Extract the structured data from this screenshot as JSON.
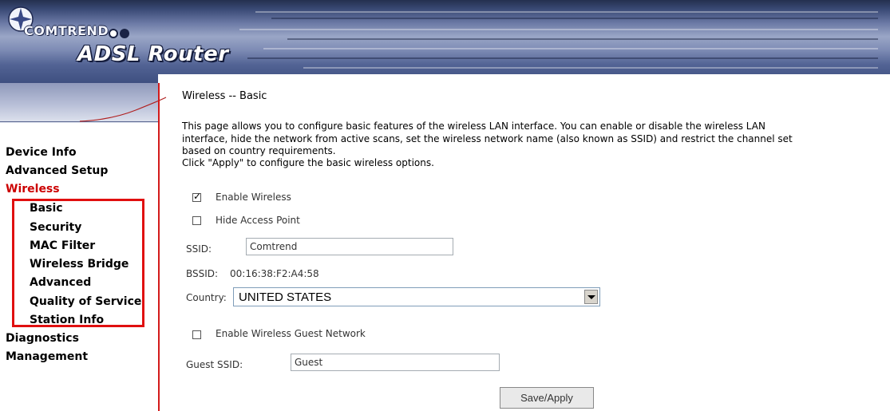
{
  "header": {
    "brand": "COMTREND",
    "product": "ADSL Router"
  },
  "nav": {
    "items": [
      {
        "label": "Device Info"
      },
      {
        "label": "Advanced Setup"
      },
      {
        "label": "Wireless",
        "active": true
      },
      {
        "label": "Basic"
      },
      {
        "label": "Security"
      },
      {
        "label": "MAC Filter"
      },
      {
        "label": "Wireless Bridge"
      },
      {
        "label": "Advanced"
      },
      {
        "label": "Quality of Service"
      },
      {
        "label": "Station Info"
      },
      {
        "label": "Diagnostics"
      },
      {
        "label": "Management"
      }
    ]
  },
  "main": {
    "title": "Wireless -- Basic",
    "description_lines": [
      "This page allows you to configure basic features of the wireless LAN interface. You can enable or disable the wireless LAN",
      "interface, hide the network from active scans, set the wireless network name (also known as SSID) and restrict the channel set",
      "based on country requirements.",
      "Click \"Apply\" to configure the basic wireless options."
    ],
    "enable_wireless": {
      "label": "Enable Wireless",
      "checked": true
    },
    "hide_ap": {
      "label": "Hide Access Point",
      "checked": false
    },
    "ssid": {
      "label": "SSID:",
      "value": "Comtrend"
    },
    "bssid": {
      "label": "BSSID:",
      "value": "00:16:38:F2:A4:58"
    },
    "country": {
      "label": "Country:",
      "value": "UNITED STATES"
    },
    "guest_network": {
      "label": "Enable Wireless Guest Network",
      "checked": false
    },
    "guest_ssid": {
      "label": "Guest SSID:",
      "value": "Guest"
    },
    "save_label": "Save/Apply"
  },
  "colors": {
    "active_nav": "#cc0000",
    "highlight_box": "#e01010"
  }
}
